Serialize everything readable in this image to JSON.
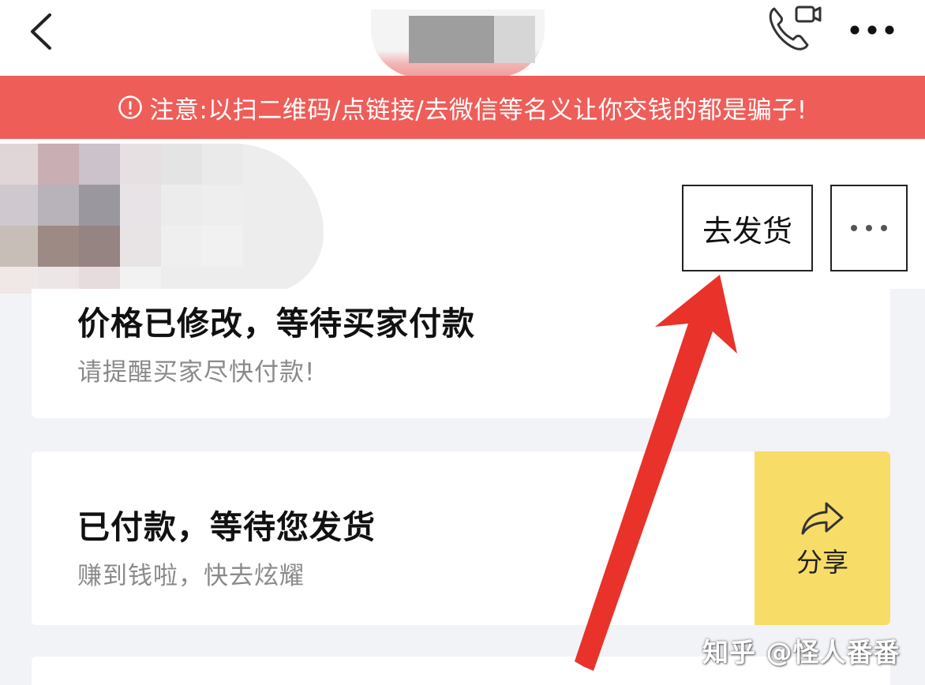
{
  "header": {
    "back_icon": "chevron-left-icon",
    "call_icon": "phone-video-icon",
    "more_icon": "ellipsis-icon"
  },
  "warning": {
    "icon": "info-circle-icon",
    "text": "注意:以扫二维码/点链接/去微信等名义让你交钱的都是骗子!",
    "color": "#ef5d58"
  },
  "order_actions": {
    "ship_label": "去发货",
    "options_icon": "ellipsis-icon"
  },
  "status_cards": [
    {
      "title": "价格已修改，等待买家付款",
      "subtitle": "请提醒买家尽快付款!"
    },
    {
      "title": "已付款，等待您发货",
      "subtitle": "赚到钱啦，快去炫耀"
    }
  ],
  "share": {
    "icon": "share-arrow-icon",
    "label": "分享",
    "color": "#f8dc68"
  },
  "annotation": {
    "arrow_color": "#e8322a"
  },
  "watermark": {
    "text": "知乎 @怪人番番"
  }
}
